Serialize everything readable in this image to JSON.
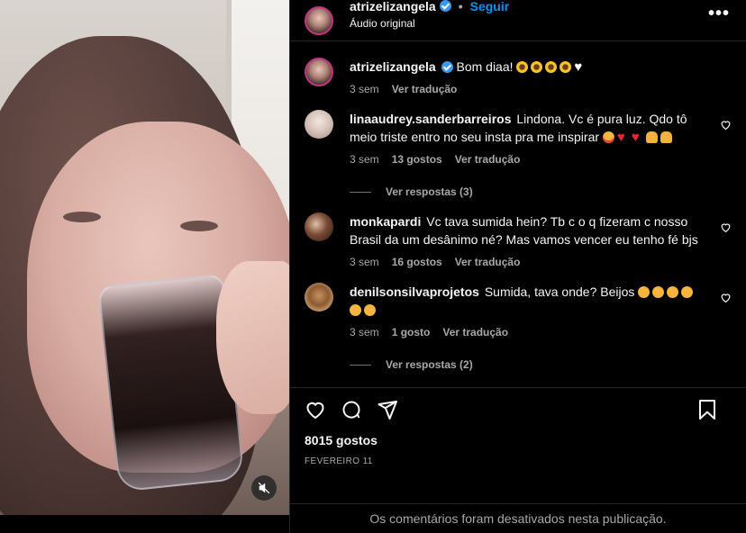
{
  "post": {
    "author": "atrizelizangela",
    "separator": "•",
    "follow_label": "Seguir",
    "audio_label": "Áudio original",
    "more_label": "•••",
    "caption": "Bom diaa!",
    "caption_time": "3 sem",
    "translate_label": "Ver tradução"
  },
  "comments": [
    {
      "user": "linaaudrey.sanderbarreiros",
      "text": "Lindona. Vc é pura luz. Qdo tô meio triste entro no seu insta pra me inspirar",
      "time": "3 sem",
      "likes": "13 gostos",
      "translate": "Ver tradução",
      "replies": "Ver respostas (3)"
    },
    {
      "user": "monkapardi",
      "text": "Vc tava sumida hein? Tb c o q fizeram c nosso Brasil da um desânimo né? Mas vamos vencer eu tenho fé bjs",
      "time": "3 sem",
      "likes": "16 gostos",
      "translate": "Ver tradução"
    },
    {
      "user": "denilsonsilvaprojetos",
      "text": "Sumida, tava onde? Beijos",
      "time": "3 sem",
      "likes": "1 gosto",
      "translate": "Ver tradução",
      "replies": "Ver respostas (2)"
    }
  ],
  "footer": {
    "likes": "8015 gostos",
    "date": "FEVEREIRO 11",
    "disabled": "Os comentários foram desativados nesta publicação."
  },
  "icons": {
    "like": "heart-icon",
    "comment": "comment-icon",
    "share": "share-icon",
    "save": "bookmark-icon",
    "mute": "mute-icon"
  }
}
